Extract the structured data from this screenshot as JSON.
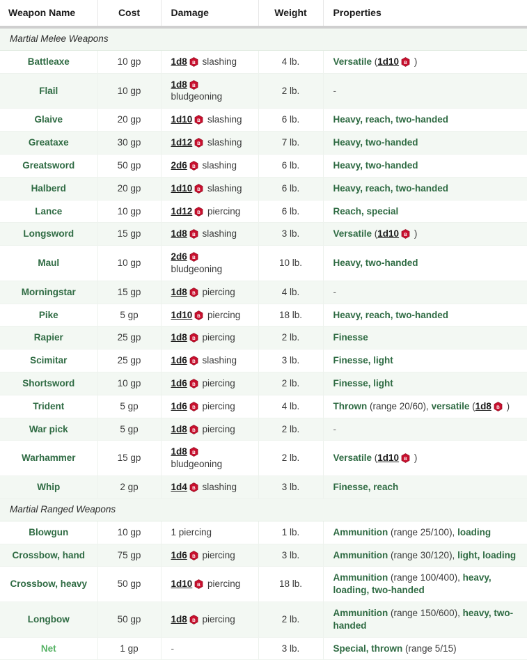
{
  "table": {
    "columns": [
      {
        "key": "name",
        "label": "Weapon Name"
      },
      {
        "key": "cost",
        "label": "Cost"
      },
      {
        "key": "damage",
        "label": "Damage"
      },
      {
        "key": "weight",
        "label": "Weight"
      },
      {
        "key": "properties",
        "label": "Properties"
      }
    ],
    "icon": {
      "name": "dice-roll-icon",
      "glyph": "B",
      "color": "#c8102e"
    },
    "colors": {
      "weapon_link": "#2f6b43",
      "weapon_link_alt": "#57b366",
      "property_link": "#2f6b43",
      "dice_link": "#1b1b1b",
      "row_stripe": "#f3f8f3",
      "row_plain": "#ffffff",
      "section_bg": "#f2f7f2",
      "header_rule": "#cfcfcf"
    },
    "sections": [
      {
        "title": "Martial Melee Weapons",
        "rows": [
          {
            "name": "Battleaxe",
            "cost": "10 gp",
            "dice": "1d8",
            "dtype": "slashing",
            "weight": "4 lb.",
            "prop_lead": "Versatile",
            "prop_open": " (",
            "prop_dice": "1d10",
            "prop_close": " )"
          },
          {
            "name": "Flail",
            "cost": "10 gp",
            "dice": "1d8",
            "dtype": "bludgeoning",
            "weight": "2 lb.",
            "prop_text": "-"
          },
          {
            "name": "Glaive",
            "cost": "20 gp",
            "dice": "1d10",
            "dtype": "slashing",
            "weight": "6 lb.",
            "prop_link": "Heavy, reach, two-handed"
          },
          {
            "name": "Greataxe",
            "cost": "30 gp",
            "dice": "1d12",
            "dtype": "slashing",
            "weight": "7 lb.",
            "prop_link": "Heavy, two-handed"
          },
          {
            "name": "Greatsword",
            "cost": "50 gp",
            "dice": "2d6",
            "dtype": "slashing",
            "weight": "6 lb.",
            "prop_link": "Heavy, two-handed"
          },
          {
            "name": "Halberd",
            "cost": "20 gp",
            "dice": "1d10",
            "dtype": "slashing",
            "weight": "6 lb.",
            "prop_link": "Heavy, reach, two-handed"
          },
          {
            "name": "Lance",
            "cost": "10 gp",
            "dice": "1d12",
            "dtype": "piercing",
            "weight": "6 lb.",
            "prop_link": "Reach, special"
          },
          {
            "name": "Longsword",
            "cost": "15 gp",
            "dice": "1d8",
            "dtype": "slashing",
            "weight": "3 lb.",
            "prop_lead": "Versatile",
            "prop_open": " (",
            "prop_dice": "1d10",
            "prop_close": " )"
          },
          {
            "name": "Maul",
            "cost": "10 gp",
            "dice": "2d6",
            "dtype": "bludgeoning",
            "weight": "10 lb.",
            "prop_link": "Heavy, two-handed"
          },
          {
            "name": "Morningstar",
            "cost": "15 gp",
            "dice": "1d8",
            "dtype": "piercing",
            "weight": "4 lb.",
            "prop_text": "-"
          },
          {
            "name": "Pike",
            "cost": "5 gp",
            "dice": "1d10",
            "dtype": "piercing",
            "weight": "18 lb.",
            "prop_link": "Heavy, reach, two-handed"
          },
          {
            "name": "Rapier",
            "cost": "25 gp",
            "dice": "1d8",
            "dtype": "piercing",
            "weight": "2 lb.",
            "prop_link": "Finesse"
          },
          {
            "name": "Scimitar",
            "cost": "25 gp",
            "dice": "1d6",
            "dtype": "slashing",
            "weight": "3 lb.",
            "prop_link": "Finesse, light"
          },
          {
            "name": "Shortsword",
            "cost": "10 gp",
            "dice": "1d6",
            "dtype": "piercing",
            "weight": "2 lb.",
            "prop_link": "Finesse, light"
          },
          {
            "name": "Trident",
            "cost": "5 gp",
            "dice": "1d6",
            "dtype": "piercing",
            "weight": "4 lb.",
            "prop_lead": "Thrown",
            "prop_mid": " (range 20/60), ",
            "prop_lead2": "versatile",
            "prop_open": " (",
            "prop_dice": "1d8",
            "prop_close": " )"
          },
          {
            "name": "War pick",
            "cost": "5 gp",
            "dice": "1d8",
            "dtype": "piercing",
            "weight": "2 lb.",
            "prop_text": "-"
          },
          {
            "name": "Warhammer",
            "cost": "15 gp",
            "dice": "1d8",
            "dtype": "bludgeoning",
            "weight": "2 lb.",
            "prop_lead": "Versatile",
            "prop_open": " (",
            "prop_dice": "1d10",
            "prop_close": " )"
          },
          {
            "name": "Whip",
            "cost": "2 gp",
            "dice": "1d4",
            "dtype": "slashing",
            "weight": "3 lb.",
            "prop_link": "Finesse, reach"
          }
        ]
      },
      {
        "title": "Martial Ranged Weapons",
        "rows": [
          {
            "name": "Blowgun",
            "cost": "10 gp",
            "damage_plain": "1 piercing",
            "weight": "1 lb.",
            "prop_lead": "Ammunition",
            "prop_mid": " (range 25/100), ",
            "prop_lead2": "loading"
          },
          {
            "name": "Crossbow, hand",
            "cost": "75 gp",
            "dice": "1d6",
            "dtype": "piercing",
            "weight": "3 lb.",
            "prop_lead": "Ammunition",
            "prop_mid": " (range 30/120), ",
            "prop_lead2": "light, loading"
          },
          {
            "name": "Crossbow, heavy",
            "cost": "50 gp",
            "dice": "1d10",
            "dtype": "piercing",
            "weight": "18 lb.",
            "prop_lead": "Ammunition",
            "prop_mid": " (range 100/400), ",
            "prop_lead2": "heavy, loading, two-handed"
          },
          {
            "name": "Longbow",
            "cost": "50 gp",
            "dice": "1d8",
            "dtype": "piercing",
            "weight": "2 lb.",
            "prop_lead": "Ammunition",
            "prop_mid": " (range 150/600), ",
            "prop_lead2": "heavy, two-handed"
          },
          {
            "name": "Net",
            "cost": "1 gp",
            "damage_plain": "-",
            "weight": "3 lb.",
            "name_style": "alt",
            "prop_lead": "Special, thrown",
            "prop_mid": " (range 5/15)"
          }
        ]
      }
    ]
  }
}
